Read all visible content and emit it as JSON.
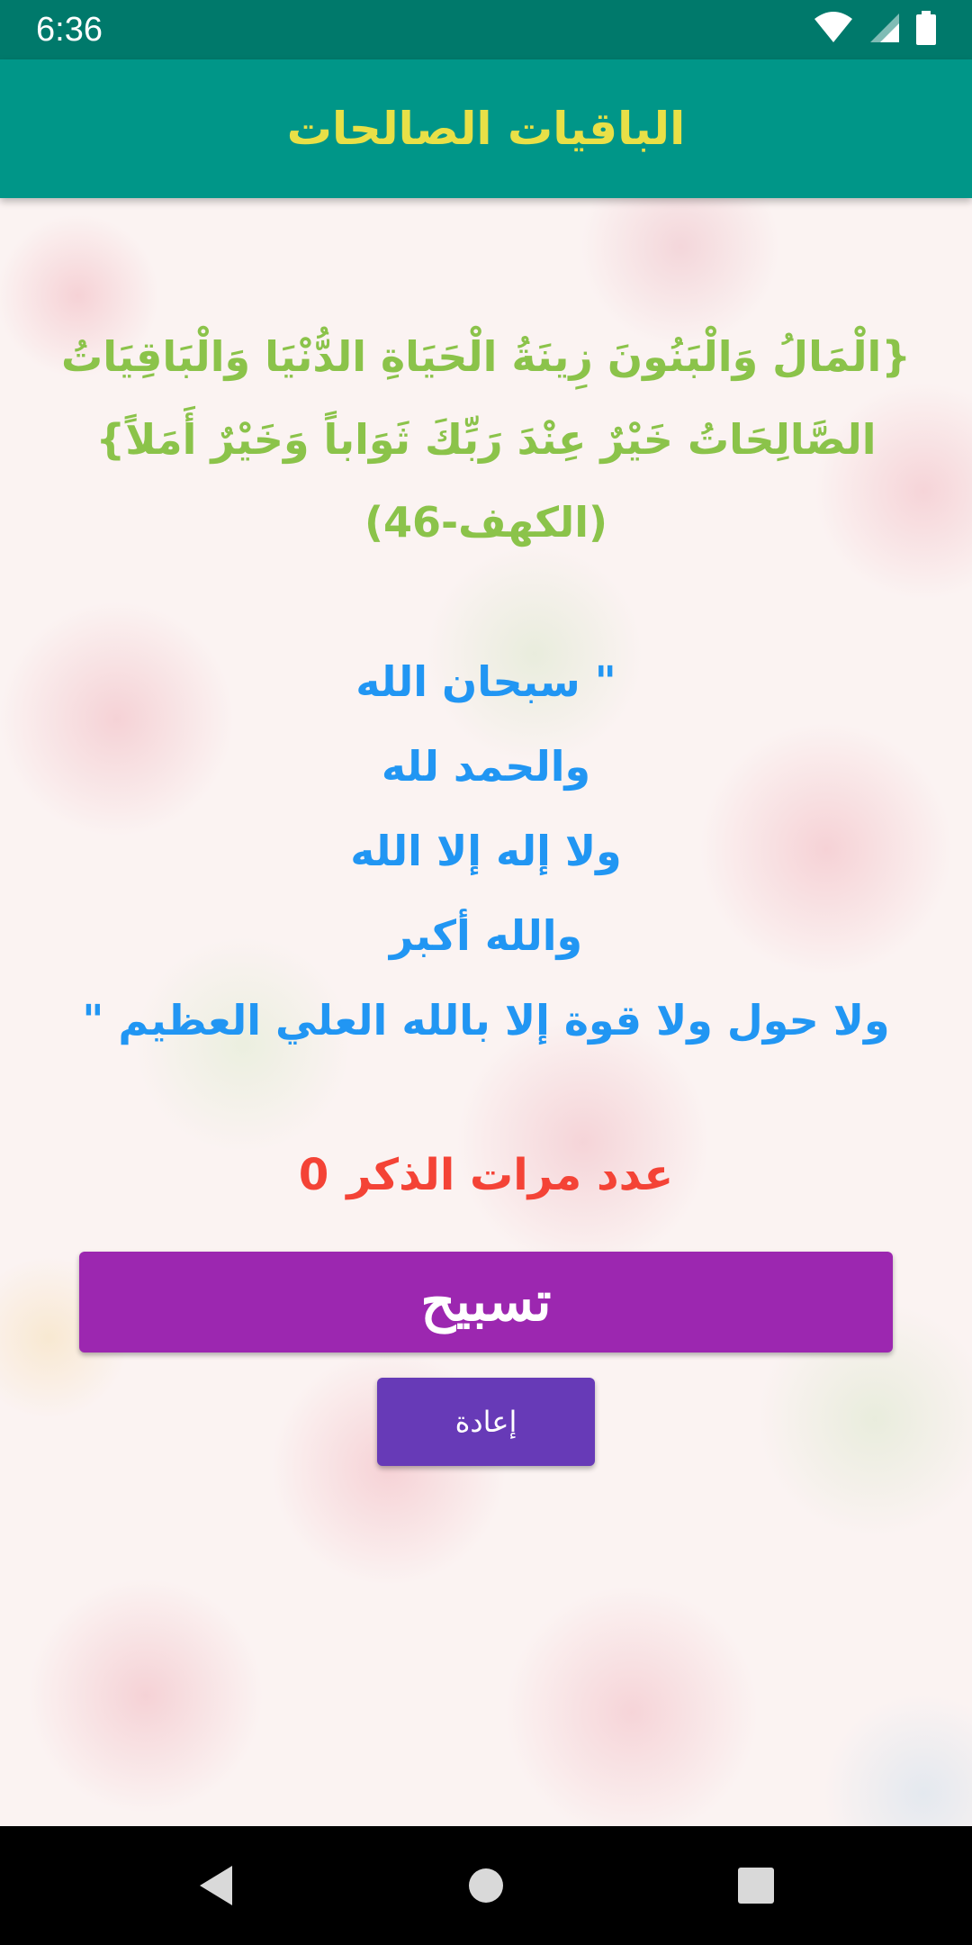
{
  "status_bar": {
    "time": "6:36",
    "icons": [
      "wifi-icon",
      "signal-icon",
      "battery-icon"
    ]
  },
  "app_bar": {
    "title": "الباقيات الصالحات"
  },
  "verse": {
    "line1": "{الْمَالُ وَالْبَنُونَ زِينَةُ الْحَيَاةِ الدُّنْيَا وَالْبَاقِيَاتُ",
    "line2": "الصَّالِحَاتُ خَيْرٌ عِنْدَ رَبِّكَ ثَوَاباً وَخَيْرٌ أَمَلاً}",
    "line3": "(الكهف-46)"
  },
  "dhikr": {
    "lines": [
      "\" سبحان الله",
      "والحمد لله",
      "ولا إله إلا الله",
      "والله أكبر",
      "ولا حول ولا قوة إلا بالله العلي العظيم \""
    ]
  },
  "counter": {
    "label": "عدد مرات الذكر",
    "value": "0"
  },
  "buttons": {
    "tasbih": "تسبيح",
    "reset": "إعادة"
  },
  "colors": {
    "status_bar": "#00796b",
    "app_bar": "#009688",
    "title": "#e8e047",
    "verse": "#8bc34a",
    "dhikr": "#2196f3",
    "counter": "#f44336",
    "tasbih_button": "#9c27b0",
    "reset_button": "#673ab7"
  },
  "nav_bar": {
    "icons": [
      "back-icon",
      "home-icon",
      "recents-icon"
    ]
  }
}
